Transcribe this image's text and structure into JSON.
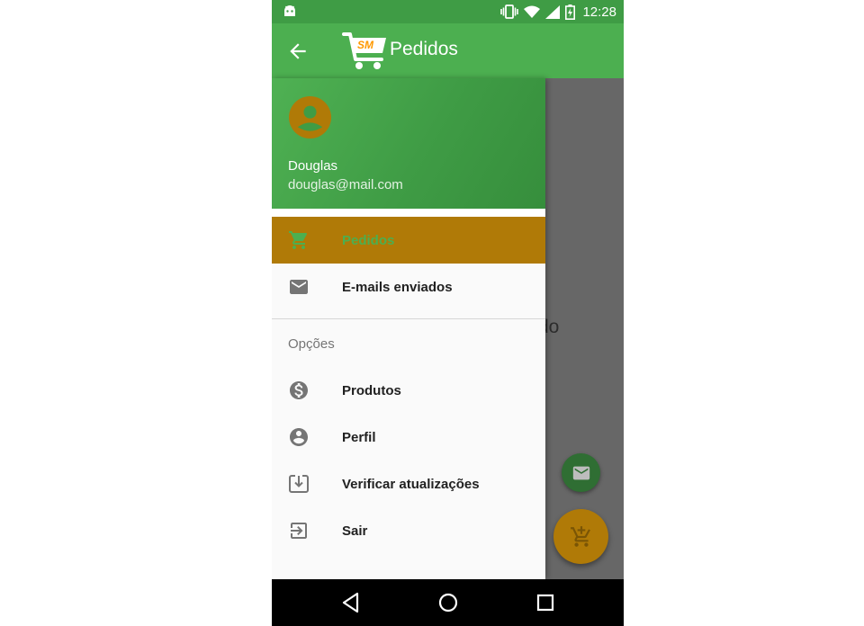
{
  "status_bar": {
    "time": "12:28",
    "icons": [
      "android-debug-icon",
      "vibrate-icon",
      "wifi-icon",
      "signal-icon",
      "battery-charging-icon"
    ]
  },
  "toolbar": {
    "back_icon": "arrow-back-icon",
    "logo_text": "SM",
    "title": "Pedidos"
  },
  "drawer": {
    "header": {
      "user_name": "Douglas",
      "user_email": "douglas@mail.com",
      "avatar_color": "#b07a07"
    },
    "primary_items": [
      {
        "label": "Pedidos",
        "icon": "cart-icon",
        "active": true
      },
      {
        "label": "E-mails enviados",
        "icon": "email-icon",
        "active": false
      }
    ],
    "section_title": "Opções",
    "option_items": [
      {
        "label": "Produtos",
        "icon": "dollar-icon"
      },
      {
        "label": "Perfil",
        "icon": "account-icon"
      },
      {
        "label": "Verificar atualizações",
        "icon": "download-icon"
      },
      {
        "label": "Sair",
        "icon": "exit-icon"
      }
    ]
  },
  "background": {
    "partial_text": "do"
  },
  "fabs": [
    {
      "icon": "email-icon",
      "color": "#2f6e33"
    },
    {
      "icon": "add-cart-icon",
      "color": "#b07a07"
    }
  ],
  "nav_bar": [
    "back-triangle-icon",
    "home-circle-icon",
    "recents-square-icon"
  ],
  "colors": {
    "primary": "#4caf50",
    "primary_dark": "#3f9c45",
    "accent": "#b07a07"
  }
}
